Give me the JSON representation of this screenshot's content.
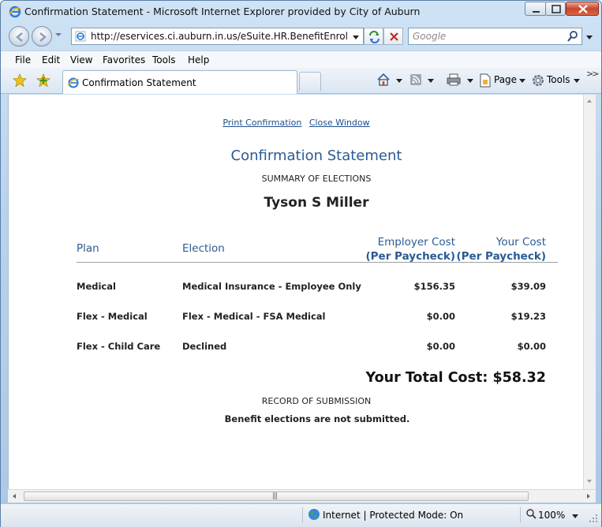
{
  "window": {
    "title": "Confirmation Statement - Microsoft Internet Explorer provided by City of Auburn"
  },
  "address_bar": {
    "url": "http://eservices.ci.auburn.in.us/eSuite.HR.BenefitEnrollment/F"
  },
  "search": {
    "placeholder": "Google"
  },
  "menu": {
    "file": "File",
    "edit": "Edit",
    "view": "View",
    "favorites": "Favorites",
    "tools": "Tools",
    "help": "Help"
  },
  "tab": {
    "label": "Confirmation Statement"
  },
  "commands": {
    "page": "Page",
    "tools": "Tools"
  },
  "page": {
    "links": {
      "print": "Print Confirmation",
      "close": "Close Window"
    },
    "title": "Confirmation Statement",
    "summary": "SUMMARY OF ELECTIONS",
    "employee_name": "Tyson S Miller",
    "table": {
      "headers": {
        "plan": "Plan",
        "election": "Election",
        "employer_cost": "Employer Cost",
        "employer_cost_sub": "(Per Paycheck)",
        "your_cost": "Your Cost",
        "your_cost_sub": "(Per Paycheck)"
      },
      "rows": [
        {
          "plan": "Medical",
          "election": "Medical Insurance - Employee Only",
          "employer_cost": "$156.35",
          "your_cost": "$39.09"
        },
        {
          "plan": "Flex - Medical",
          "election": "Flex - Medical - FSA Medical",
          "employer_cost": "$0.00",
          "your_cost": "$19.23"
        },
        {
          "plan": "Flex - Child Care",
          "election": "Declined",
          "employer_cost": "$0.00",
          "your_cost": "$0.00"
        }
      ]
    },
    "total_label": "Your Total Cost: $58.32",
    "record": "RECORD OF SUBMISSION",
    "not_submitted": "Benefit elections are not submitted."
  },
  "status": {
    "zone": "Internet | Protected Mode: On",
    "zoom": "100%"
  }
}
